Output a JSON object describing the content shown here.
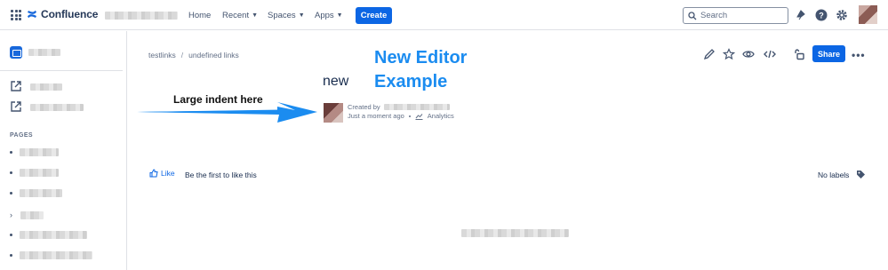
{
  "topbar": {
    "product_name": "Confluence",
    "nav": [
      {
        "label": "Home",
        "has_menu": false
      },
      {
        "label": "Recent",
        "has_menu": true
      },
      {
        "label": "Spaces",
        "has_menu": true
      },
      {
        "label": "Apps",
        "has_menu": true
      }
    ],
    "create_label": "Create",
    "search_placeholder": "Search",
    "icons": [
      "app-switcher-icon",
      "notifications-icon",
      "help-icon",
      "settings-icon"
    ]
  },
  "page": {
    "breadcrumb": [
      "testlinks",
      "undefined links"
    ],
    "title_word": "new",
    "annotation_title_line1": "New Editor",
    "annotation_title_line2": "Example",
    "arrow_label": "Large indent here",
    "created_by_label": "Created by",
    "timestamp": "Just a moment ago",
    "analytics_label": "Analytics",
    "share_label": "Share",
    "like_label": "Like",
    "like_note": "Be the first to like this",
    "no_labels": "No labels"
  },
  "sidebar": {
    "pages_heading": "PAGES"
  },
  "colors": {
    "primary": "#0c66e4",
    "annotation": "#1b8cf0",
    "text": "#172b4d",
    "subtle": "#626f86"
  }
}
